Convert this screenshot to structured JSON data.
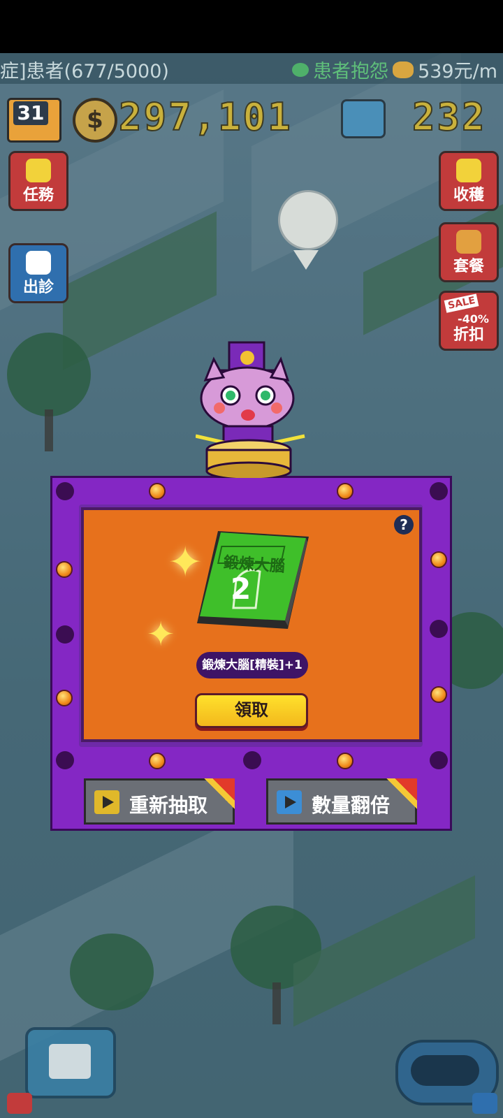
{
  "top_bar": {
    "patients": "症]患者(677/5000)",
    "complaints": "患者抱怨",
    "income": "539元/m"
  },
  "hud": {
    "day": "31",
    "coin_symbol": "$",
    "money": "297,101",
    "gems": "232"
  },
  "left_menu": [
    {
      "label": "任務",
      "icon": "lightbulb-icon",
      "color": "#c23b3b"
    },
    {
      "label": "出診",
      "icon": "ambulance-icon",
      "color": "#2f6fae"
    }
  ],
  "right_menu": [
    {
      "label": "收穫",
      "icon": "harvest-icon",
      "color": "#c23b3b"
    },
    {
      "label": "套餐",
      "icon": "burger-icon",
      "color": "#c23b3b"
    },
    {
      "label": "折扣",
      "icon": "sale-tag-icon",
      "color": "#c23b3b",
      "badge": "SALE",
      "sub": "-40%"
    }
  ],
  "modal": {
    "help": "?",
    "book_title": "鍛煉大腦",
    "book_number": "2",
    "reward_text": "鍛煉大腦[精裝]+1",
    "claim_label": "領取",
    "reroll_label": "重新抽取",
    "double_label": "數量翻倍"
  },
  "colors": {
    "frame": "#8427c4",
    "card": "#e7711c",
    "claim": "#ffd62a",
    "reroll_icon": "#e0b82a",
    "double_icon": "#3c8ed6"
  }
}
